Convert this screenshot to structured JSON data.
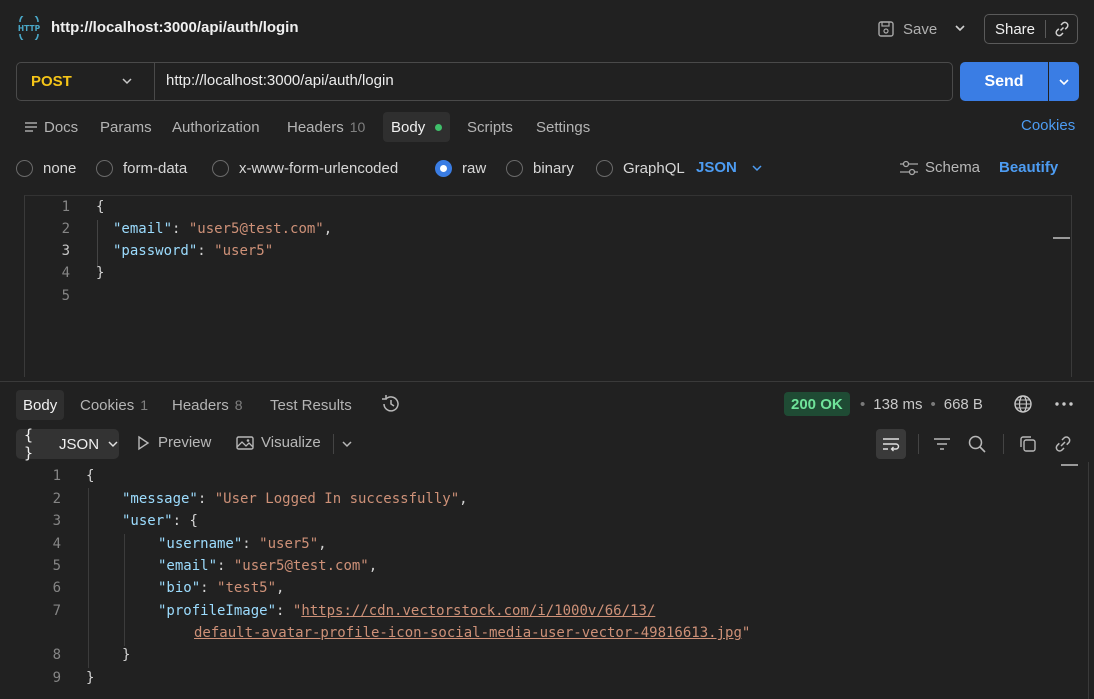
{
  "request": {
    "title": "http://localhost:3000/api/auth/login",
    "save_label": "Save",
    "share_label": "Share",
    "method": "POST",
    "url": "http://localhost:3000/api/auth/login",
    "send_label": "Send",
    "tabs": [
      {
        "label": "Docs"
      },
      {
        "label": "Params"
      },
      {
        "label": "Authorization"
      },
      {
        "label": "Headers",
        "count": "10"
      },
      {
        "label": "Body"
      },
      {
        "label": "Scripts"
      },
      {
        "label": "Settings"
      }
    ],
    "cookies_label": "Cookies",
    "body_types": [
      "none",
      "form-data",
      "x-www-form-urlencoded",
      "raw",
      "binary",
      "GraphQL"
    ],
    "selected_body_type": "raw",
    "body_format": "JSON",
    "schema_label": "Schema",
    "beautify_label": "Beautify",
    "code_lines": [
      {
        "n": "1",
        "text": "{"
      },
      {
        "n": "2",
        "key": "\"email\"",
        "value": "\"user5@test.com\"",
        "trail": ","
      },
      {
        "n": "3",
        "key": "\"password\"",
        "value": "\"user5\"",
        "trail": ""
      },
      {
        "n": "4",
        "text": "}"
      },
      {
        "n": "5",
        "text": ""
      }
    ]
  },
  "response": {
    "tabs": [
      {
        "label": "Body"
      },
      {
        "label": "Cookies",
        "count": "1"
      },
      {
        "label": "Headers",
        "count": "8"
      },
      {
        "label": "Test Results"
      }
    ],
    "status": "200 OK",
    "time": "138 ms",
    "size": "668 B",
    "format_label": "JSON",
    "format_icon": "{ }",
    "preview_label": "Preview",
    "visualize_label": "Visualize",
    "line_numbers": [
      "1",
      "2",
      "3",
      "4",
      "5",
      "6",
      "7",
      "8",
      "9"
    ],
    "body": {
      "open": "{",
      "message_key": "\"message\"",
      "message_value": "\"User Logged In successfully\"",
      "user_key": "\"user\"",
      "user_open": "{",
      "username_key": "\"username\"",
      "username_value": "\"user5\"",
      "email_key": "\"email\"",
      "email_value": "\"user5@test.com\"",
      "bio_key": "\"bio\"",
      "bio_value": "\"test5\"",
      "profile_key": "\"profileImage\"",
      "profile_url_line1": "https://cdn.vectorstock.com/i/1000v/66/13/",
      "profile_url_line2": "default-avatar-profile-icon-social-media-user-vector-49816613.jpg",
      "user_close": "}",
      "close": "}"
    }
  },
  "colors": {
    "accent": "#3a7de4",
    "link": "#4d9cf2",
    "method": "#f5c518",
    "status_ok_bg": "#1f4b34",
    "status_ok_text": "#6fe39a",
    "json_key": "#9cdcfe",
    "json_string": "#ce9178"
  }
}
